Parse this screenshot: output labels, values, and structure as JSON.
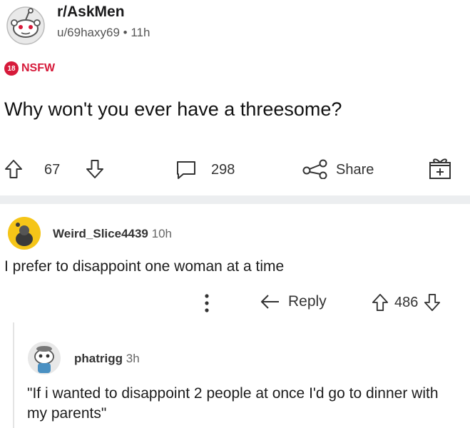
{
  "post": {
    "subreddit": "r/AskMen",
    "author": "u/69haxy69",
    "separator": "•",
    "age": "11h",
    "nsfw_badge": "18",
    "nsfw_label": "NSFW",
    "title": "Why won't you ever have a threesome?",
    "upvotes": "67",
    "comments": "298",
    "share_label": "Share"
  },
  "comments": [
    {
      "username": "Weird_Slice4439",
      "age": "10h",
      "body": "I prefer to disappoint one woman at a time",
      "reply_label": "Reply",
      "score": "486"
    },
    {
      "username": "phatrigg",
      "age": "3h",
      "body": "\"If i wanted to disappoint 2 people at once I'd go to dinner with my parents\""
    }
  ],
  "icons": {
    "post_avatar": "snoo-avatar-icon",
    "upvote": "upvote-arrow-icon",
    "downvote": "downvote-arrow-icon",
    "comment": "comment-bubble-icon",
    "share": "share-icon",
    "award": "award-gift-icon",
    "more": "more-kebab-icon",
    "reply": "reply-arrow-icon"
  },
  "colors": {
    "nsfw": "#d61a3a",
    "divider": "#eceef0",
    "comment1_avatar": "#f5c518"
  }
}
